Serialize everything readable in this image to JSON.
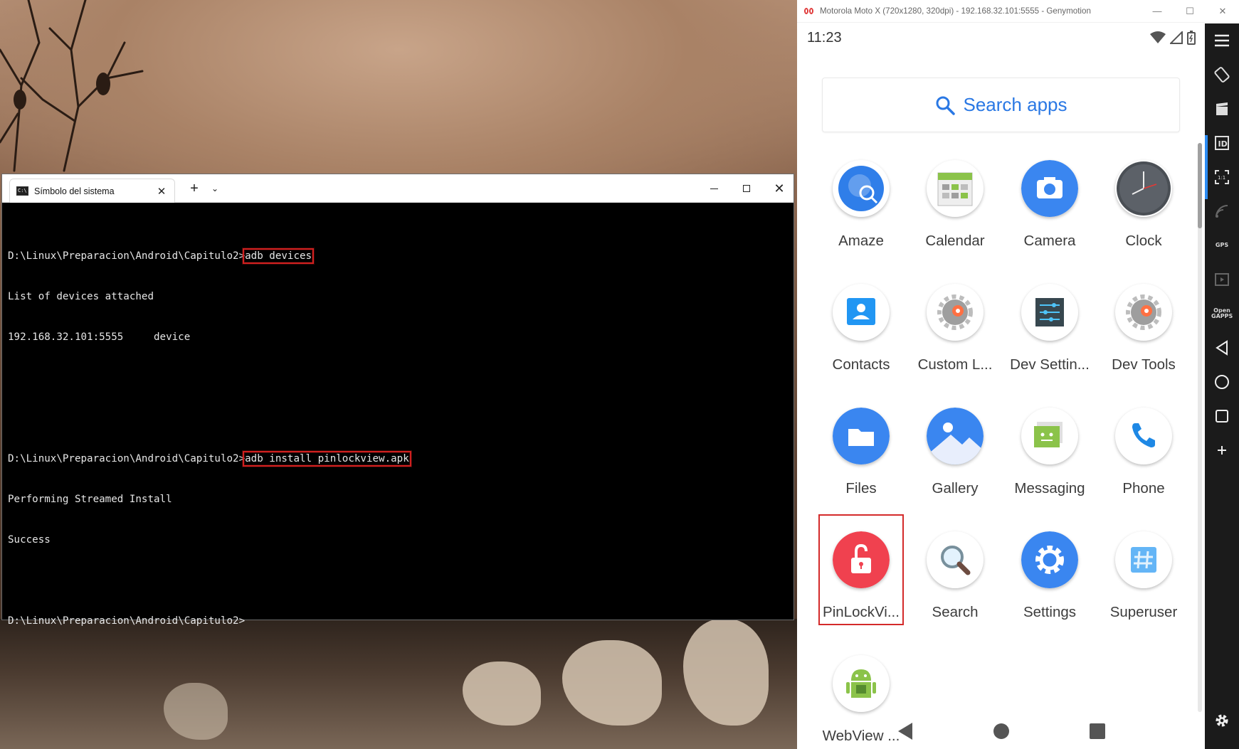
{
  "cmd": {
    "tab_title": "Símbolo del sistema",
    "lines": [
      {
        "prompt": "D:\\Linux\\Preparacion\\Android\\Capitulo2>",
        "command": "adb devices"
      },
      {
        "text": "List of devices attached"
      },
      {
        "text": "192.168.32.101:5555     device"
      },
      {
        "text": ""
      },
      {
        "text": ""
      },
      {
        "prompt": "D:\\Linux\\Preparacion\\Android\\Capitulo2>",
        "command": "adb install pinlockview.apk"
      },
      {
        "text": "Performing Streamed Install"
      },
      {
        "text": "Success"
      },
      {
        "text": ""
      },
      {
        "prompt": "D:\\Linux\\Preparacion\\Android\\Capitulo2>",
        "command": ""
      }
    ]
  },
  "emulator": {
    "title": "Motorola Moto X (720x1280, 320dpi) - 192.168.32.101:5555 - Genymotion",
    "clock": "11:23",
    "search_label": "Search apps",
    "apps": [
      {
        "label": "Amaze",
        "icon": "amaze-icon"
      },
      {
        "label": "Calendar",
        "icon": "calendar-icon"
      },
      {
        "label": "Camera",
        "icon": "camera-icon"
      },
      {
        "label": "Clock",
        "icon": "clock-icon"
      },
      {
        "label": "Contacts",
        "icon": "contacts-icon"
      },
      {
        "label": "Custom L...",
        "icon": "custom-locale-icon"
      },
      {
        "label": "Dev Settin...",
        "icon": "dev-settings-icon"
      },
      {
        "label": "Dev Tools",
        "icon": "dev-tools-icon"
      },
      {
        "label": "Files",
        "icon": "files-icon"
      },
      {
        "label": "Gallery",
        "icon": "gallery-icon"
      },
      {
        "label": "Messaging",
        "icon": "messaging-icon"
      },
      {
        "label": "Phone",
        "icon": "phone-icon"
      },
      {
        "label": "PinLockVi...",
        "icon": "pinlockview-icon"
      },
      {
        "label": "Search",
        "icon": "search-app-icon"
      },
      {
        "label": "Settings",
        "icon": "settings-icon"
      },
      {
        "label": "Superuser",
        "icon": "superuser-icon"
      },
      {
        "label": "WebView ...",
        "icon": "webview-icon"
      }
    ],
    "toolbar": {
      "gps_label": "GPS",
      "opengapps_label": "Open GAPPS"
    }
  },
  "colors": {
    "accent_blue": "#2a78e4",
    "highlight_red": "#d42a2a",
    "terminal_bg": "#000000",
    "terminal_fg": "#e6e6e6"
  }
}
